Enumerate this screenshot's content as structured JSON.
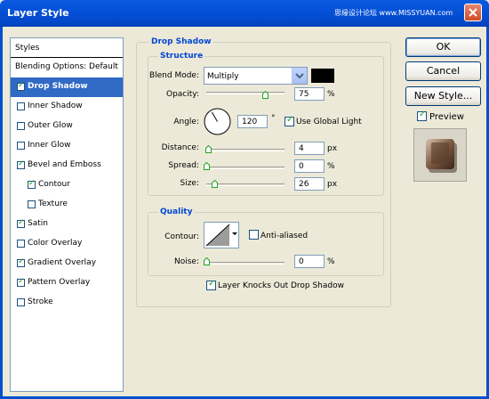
{
  "window": {
    "title": "Layer Style",
    "watermark": "思缘设计论坛 www.MISSYUAN.com"
  },
  "sidebar": {
    "header": "Styles",
    "items": [
      {
        "label": "Blending Options: Default",
        "checkbox": false,
        "checked": false,
        "selected": false,
        "indent": false
      },
      {
        "label": "Drop Shadow",
        "checkbox": true,
        "checked": true,
        "selected": true,
        "indent": false
      },
      {
        "label": "Inner Shadow",
        "checkbox": true,
        "checked": false,
        "selected": false,
        "indent": false
      },
      {
        "label": "Outer Glow",
        "checkbox": true,
        "checked": false,
        "selected": false,
        "indent": false
      },
      {
        "label": "Inner Glow",
        "checkbox": true,
        "checked": false,
        "selected": false,
        "indent": false
      },
      {
        "label": "Bevel and Emboss",
        "checkbox": true,
        "checked": true,
        "selected": false,
        "indent": false
      },
      {
        "label": "Contour",
        "checkbox": true,
        "checked": true,
        "selected": false,
        "indent": true
      },
      {
        "label": "Texture",
        "checkbox": true,
        "checked": false,
        "selected": false,
        "indent": true
      },
      {
        "label": "Satin",
        "checkbox": true,
        "checked": true,
        "selected": false,
        "indent": false
      },
      {
        "label": "Color Overlay",
        "checkbox": true,
        "checked": false,
        "selected": false,
        "indent": false
      },
      {
        "label": "Gradient Overlay",
        "checkbox": true,
        "checked": true,
        "selected": false,
        "indent": false
      },
      {
        "label": "Pattern Overlay",
        "checkbox": true,
        "checked": true,
        "selected": false,
        "indent": false
      },
      {
        "label": "Stroke",
        "checkbox": true,
        "checked": false,
        "selected": false,
        "indent": false
      }
    ]
  },
  "drop_shadow": {
    "title": "Drop Shadow",
    "structure": {
      "title": "Structure",
      "blend_mode_label": "Blend Mode:",
      "blend_mode_value": "Multiply",
      "shadow_color": "#000000",
      "opacity_label": "Opacity:",
      "opacity_value": "75",
      "opacity_unit": "%",
      "opacity_fraction": 0.75,
      "angle_label": "Angle:",
      "angle_value": "120",
      "angle_unit": "°",
      "use_global_light_label": "Use Global Light",
      "use_global_light": true,
      "distance_label": "Distance:",
      "distance_value": "4",
      "distance_unit": "px",
      "distance_fraction": 0.02,
      "spread_label": "Spread:",
      "spread_value": "0",
      "spread_unit": "%",
      "spread_fraction": 0.0,
      "size_label": "Size:",
      "size_value": "26",
      "size_unit": "px",
      "size_fraction": 0.104
    },
    "quality": {
      "title": "Quality",
      "contour_label": "Contour:",
      "anti_aliased_label": "Anti-aliased",
      "anti_aliased": false,
      "noise_label": "Noise:",
      "noise_value": "0",
      "noise_unit": "%",
      "noise_fraction": 0.0
    },
    "knocks_out_label": "Layer Knocks Out Drop Shadow",
    "knocks_out": true
  },
  "buttons": {
    "ok": "OK",
    "cancel": "Cancel",
    "new_style": "New Style..."
  },
  "preview": {
    "label": "Preview",
    "checked": true
  }
}
